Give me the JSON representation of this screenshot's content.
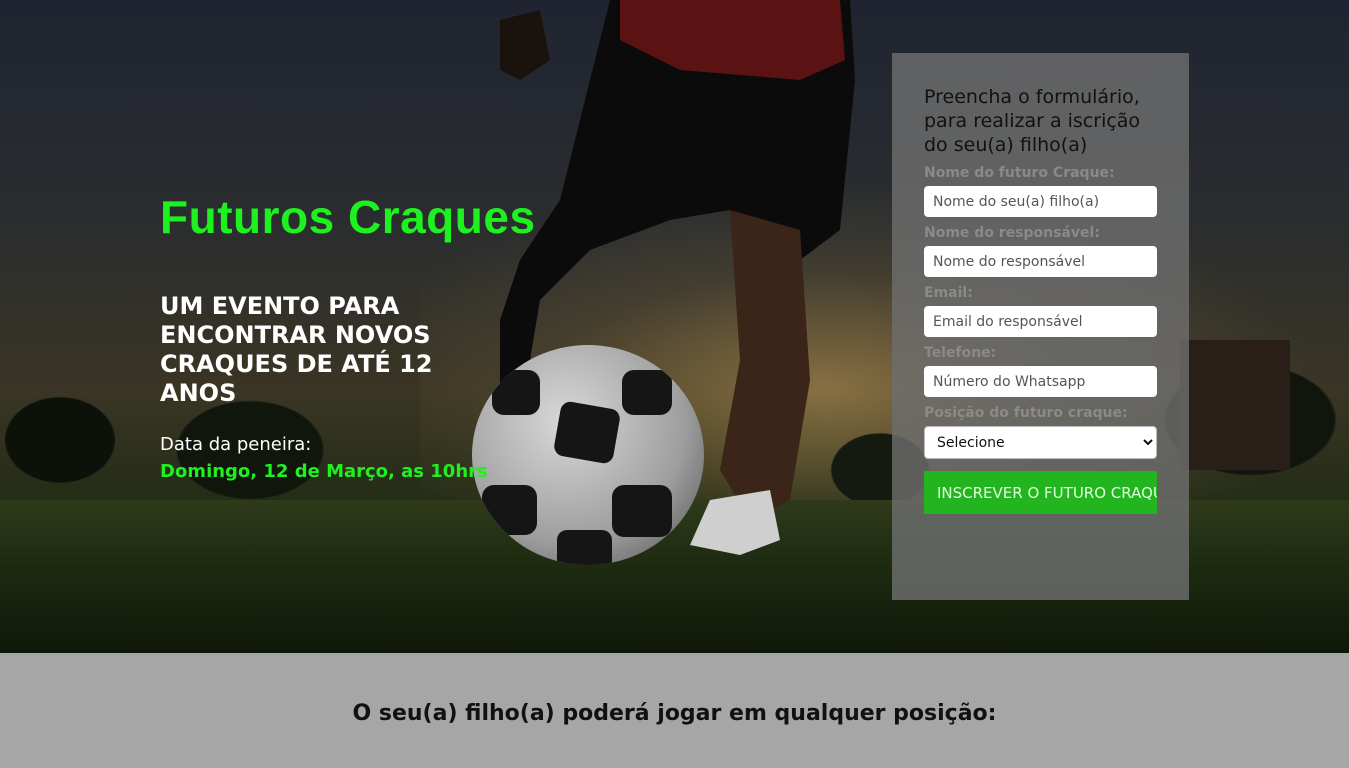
{
  "hero": {
    "title": "Futuros Craques",
    "subtitle": "UM EVENTO PARA ENCONTRAR NOVOS CRAQUES DE ATÉ 12 ANOS",
    "date_label": "Data da peneira:",
    "date_value": "Domingo, 12 de Março, as 10hrs",
    "accent_color": "#1ff01f"
  },
  "form": {
    "intro": "Preencha o formulário, para realizar a iscrição do seu(a) filho(a)",
    "fields": [
      {
        "label": "Nome do futuro Craque:",
        "placeholder": "Nome do seu(a) filho(a)"
      },
      {
        "label": "Nome do responsável:",
        "placeholder": "Nome do responsável"
      },
      {
        "label": "Email:",
        "placeholder": "Email do responsável"
      },
      {
        "label": "Telefone:",
        "placeholder": "Número do Whatsapp"
      }
    ],
    "position_label": "Posição do futuro craque:",
    "position_selected": "Selecione",
    "submit_label": "INSCREVER O FUTURO CRAQUE",
    "button_color": "#22b51f"
  },
  "positions": {
    "heading": "O seu(a) filho(a) poderá jogar em qualquer posição:"
  }
}
